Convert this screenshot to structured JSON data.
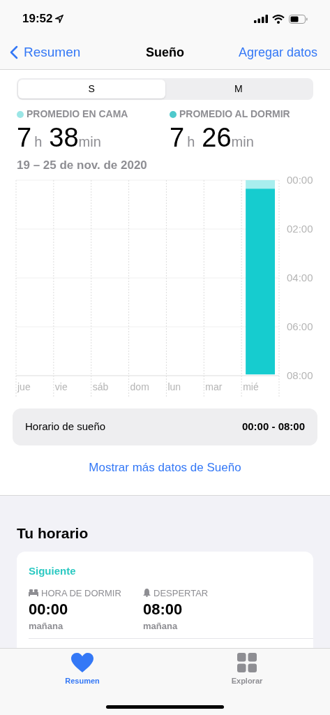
{
  "status_bar": {
    "time": "19:52"
  },
  "nav": {
    "back": "Resumen",
    "title": "Sueño",
    "action": "Agregar datos"
  },
  "segments": [
    {
      "label": "S",
      "selected": true
    },
    {
      "label": "M",
      "selected": false
    }
  ],
  "stats": [
    {
      "label": "PROMEDIO EN CAMA",
      "color": "#9be6e6",
      "hours": "7",
      "h_unit": "h",
      "minutes": "38",
      "min_unit": "min"
    },
    {
      "label": "PROMEDIO AL DORMIR",
      "color": "#4fc9cc",
      "hours": "7",
      "h_unit": "h",
      "minutes": "26",
      "min_unit": "min"
    }
  ],
  "date_range": "19 – 25 de nov. de 2020",
  "chart_data": {
    "type": "bar",
    "stacked": true,
    "categories": [
      "jue",
      "vie",
      "sáb",
      "dom",
      "lun",
      "mar",
      "mié"
    ],
    "grid": true,
    "series": [
      {
        "color": "#a8eeee",
        "values": [
          null,
          null,
          null,
          null,
          null,
          null,
          0.35
        ]
      },
      {
        "color": "#16cccf",
        "values": [
          null,
          null,
          null,
          null,
          null,
          null,
          7.6
        ]
      }
    ],
    "ylim": [
      8,
      0
    ],
    "yticks": [
      {
        "value": 0,
        "label": "00:00"
      },
      {
        "value": 2,
        "label": "02:00"
      },
      {
        "value": 4,
        "label": "04:00"
      },
      {
        "value": 6,
        "label": "06:00"
      },
      {
        "value": 8,
        "label": "08:00"
      }
    ]
  },
  "schedule_row": {
    "label": "Horario de sueño",
    "value": "00:00 - 08:00"
  },
  "more_link": "Mostrar más datos de Sueño",
  "your_schedule": {
    "title": "Tu horario",
    "next": "Siguiente",
    "items": [
      {
        "kind": "bed",
        "label": "HORA DE DORMIR",
        "time": "00:00",
        "day": "mañana"
      },
      {
        "kind": "alarm",
        "label": "DESPERTAR",
        "time": "08:00",
        "day": "mañana"
      }
    ]
  },
  "tab_bar": [
    {
      "kind": "heart",
      "label": "Resumen",
      "selected": true
    },
    {
      "kind": "grid",
      "label": "Explorar",
      "selected": false
    }
  ]
}
